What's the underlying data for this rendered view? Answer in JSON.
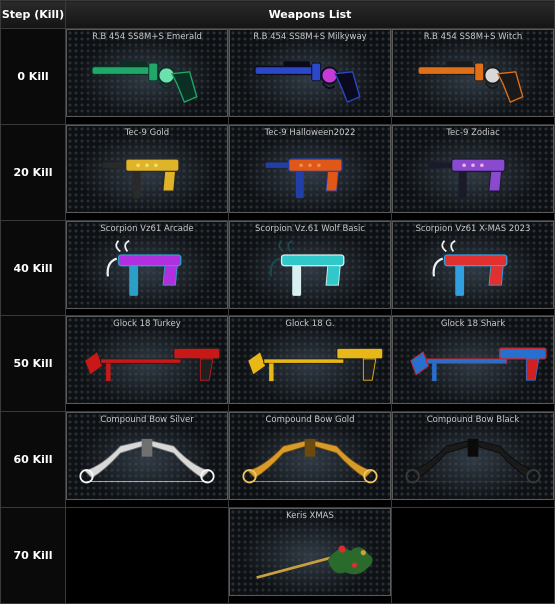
{
  "header": {
    "step": "Step (Kill)",
    "weapons": "Weapons List"
  },
  "rows": [
    {
      "step": "0 Kill",
      "items": [
        {
          "name": "R.B 454 SS8M+S Emerald",
          "type": "revolver",
          "colors": [
            "#1fa86a",
            "#0b2f22",
            "#6de0b0"
          ]
        },
        {
          "name": "R.B 454 SS8M+S Milkyway",
          "type": "revolver",
          "colors": [
            "#2a48c8",
            "#0a0a1c",
            "#c83ad8"
          ]
        },
        {
          "name": "R.B 454 SS8M+S Witch",
          "type": "revolver",
          "colors": [
            "#e07018",
            "#1a1a1a",
            "#d8d8d8"
          ]
        }
      ]
    },
    {
      "step": "20 Kill",
      "items": [
        {
          "name": "Tec-9 Gold",
          "type": "smg",
          "colors": [
            "#e0b428",
            "#2a2a2a",
            "#f4de7c"
          ]
        },
        {
          "name": "Tec-9 Halloween2022",
          "type": "smg",
          "colors": [
            "#e05818",
            "#2040a8",
            "#f09040"
          ]
        },
        {
          "name": "Tec-9 Zodiac",
          "type": "smg",
          "colors": [
            "#8a4ad0",
            "#1a1a2a",
            "#f0b0e8"
          ]
        }
      ]
    },
    {
      "step": "40 Kill",
      "items": [
        {
          "name": "Scorpion Vz61 Arcade",
          "type": "scorpion",
          "colors": [
            "#b030e0",
            "#2aa0c8",
            "#f0f0f0"
          ]
        },
        {
          "name": "Scorpion Vz.61 Wolf Basic",
          "type": "scorpion",
          "colors": [
            "#30c8c8",
            "#d8f0f0",
            "#1a4a50"
          ]
        },
        {
          "name": "Scorpion Vz61 X-MAS 2023",
          "type": "scorpion",
          "colors": [
            "#e03030",
            "#30a0e0",
            "#f0f0f0"
          ]
        }
      ]
    },
    {
      "step": "50 Kill",
      "items": [
        {
          "name": "Glock 18 Turkey",
          "type": "glock",
          "colors": [
            "#c81818",
            "#202020",
            "#e84040"
          ]
        },
        {
          "name": "Glock 18 G.",
          "type": "glock",
          "colors": [
            "#e8b818",
            "#202020",
            "#f8e060"
          ]
        },
        {
          "name": "Glock 18 Shark",
          "type": "glock",
          "colors": [
            "#2870d0",
            "#d02020",
            "#e0e0e0"
          ]
        }
      ]
    },
    {
      "step": "60 Kill",
      "items": [
        {
          "name": "Compound Bow Silver",
          "type": "bow",
          "colors": [
            "#d8d8d8",
            "#f8f8f8",
            "#707070"
          ]
        },
        {
          "name": "Compound Bow Gold",
          "type": "bow",
          "colors": [
            "#d89a28",
            "#f0c860",
            "#6a4a10"
          ]
        },
        {
          "name": "Compound Bow Black",
          "type": "bow",
          "colors": [
            "#1a1a1a",
            "#3a3a3a",
            "#0a0a0a"
          ]
        }
      ]
    },
    {
      "step": "70 Kill",
      "items": [
        null,
        {
          "name": "Keris XMAS",
          "type": "keris",
          "colors": [
            "#2a6a2a",
            "#c8a040",
            "#d83030"
          ]
        },
        null
      ]
    }
  ]
}
